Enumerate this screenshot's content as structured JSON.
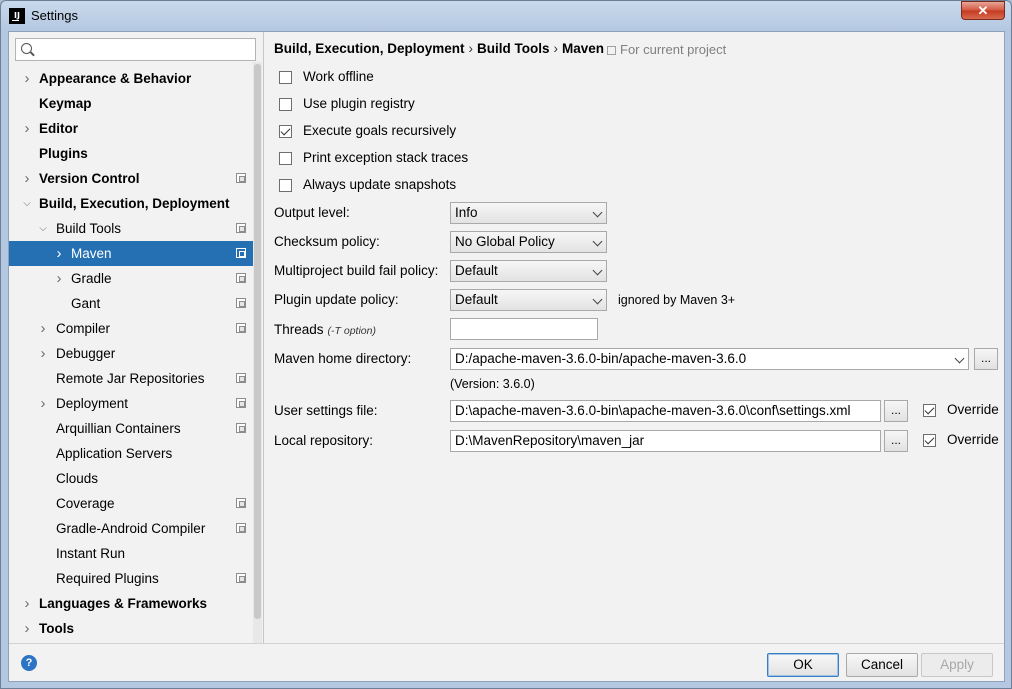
{
  "window": {
    "title": "Settings",
    "close_label": "✕"
  },
  "search": {
    "placeholder": ""
  },
  "tree": [
    {
      "label": "Appearance & Behavior",
      "depth": 0,
      "arrow": "right",
      "bold": true,
      "proj": false,
      "selected": false
    },
    {
      "label": "Keymap",
      "depth": 0,
      "arrow": "",
      "bold": true,
      "proj": false,
      "selected": false
    },
    {
      "label": "Editor",
      "depth": 0,
      "arrow": "right",
      "bold": true,
      "proj": false,
      "selected": false
    },
    {
      "label": "Plugins",
      "depth": 0,
      "arrow": "",
      "bold": true,
      "proj": false,
      "selected": false
    },
    {
      "label": "Version Control",
      "depth": 0,
      "arrow": "right",
      "bold": true,
      "proj": true,
      "selected": false
    },
    {
      "label": "Build, Execution, Deployment",
      "depth": 0,
      "arrow": "down",
      "bold": true,
      "proj": false,
      "selected": false
    },
    {
      "label": "Build Tools",
      "depth": 1,
      "arrow": "down",
      "bold": false,
      "proj": true,
      "selected": false
    },
    {
      "label": "Maven",
      "depth": 2,
      "arrow": "right",
      "bold": false,
      "proj": true,
      "selected": true
    },
    {
      "label": "Gradle",
      "depth": 2,
      "arrow": "right",
      "bold": false,
      "proj": true,
      "selected": false
    },
    {
      "label": "Gant",
      "depth": 2,
      "arrow": "",
      "bold": false,
      "proj": true,
      "selected": false
    },
    {
      "label": "Compiler",
      "depth": 1,
      "arrow": "right",
      "bold": false,
      "proj": true,
      "selected": false
    },
    {
      "label": "Debugger",
      "depth": 1,
      "arrow": "right",
      "bold": false,
      "proj": false,
      "selected": false
    },
    {
      "label": "Remote Jar Repositories",
      "depth": 1,
      "arrow": "",
      "bold": false,
      "proj": true,
      "selected": false
    },
    {
      "label": "Deployment",
      "depth": 1,
      "arrow": "right",
      "bold": false,
      "proj": true,
      "selected": false
    },
    {
      "label": "Arquillian Containers",
      "depth": 1,
      "arrow": "",
      "bold": false,
      "proj": true,
      "selected": false
    },
    {
      "label": "Application Servers",
      "depth": 1,
      "arrow": "",
      "bold": false,
      "proj": false,
      "selected": false
    },
    {
      "label": "Clouds",
      "depth": 1,
      "arrow": "",
      "bold": false,
      "proj": false,
      "selected": false
    },
    {
      "label": "Coverage",
      "depth": 1,
      "arrow": "",
      "bold": false,
      "proj": true,
      "selected": false
    },
    {
      "label": "Gradle-Android Compiler",
      "depth": 1,
      "arrow": "",
      "bold": false,
      "proj": true,
      "selected": false
    },
    {
      "label": "Instant Run",
      "depth": 1,
      "arrow": "",
      "bold": false,
      "proj": false,
      "selected": false
    },
    {
      "label": "Required Plugins",
      "depth": 1,
      "arrow": "",
      "bold": false,
      "proj": true,
      "selected": false
    },
    {
      "label": "Languages & Frameworks",
      "depth": 0,
      "arrow": "right",
      "bold": true,
      "proj": false,
      "selected": false
    },
    {
      "label": "Tools",
      "depth": 0,
      "arrow": "right",
      "bold": true,
      "proj": false,
      "selected": false
    }
  ],
  "breadcrumb": {
    "part1": "Build, Execution, Deployment",
    "part2": "Build Tools",
    "part3": "Maven",
    "sep": "›",
    "scope": "For current project"
  },
  "checkboxes": {
    "work_offline": {
      "label": "Work offline",
      "checked": false
    },
    "use_plugin_registry": {
      "label": "Use plugin registry",
      "checked": false
    },
    "execute_goals": {
      "label": "Execute goals recursively",
      "checked": true
    },
    "print_exception": {
      "label": "Print exception stack traces",
      "checked": false
    },
    "always_update": {
      "label": "Always update snapshots",
      "checked": false
    }
  },
  "fields": {
    "output_level": {
      "label": "Output level:",
      "value": "Info"
    },
    "checksum_policy": {
      "label": "Checksum policy:",
      "value": "No Global Policy"
    },
    "multiproject": {
      "label": "Multiproject build fail policy:",
      "value": "Default"
    },
    "plugin_update": {
      "label": "Plugin update policy:",
      "value": "Default",
      "note": "ignored by Maven 3+"
    },
    "threads": {
      "label": "Threads",
      "hint": "(-T option)",
      "value": ""
    },
    "maven_home": {
      "label": "Maven home directory:",
      "value": "D:/apache-maven-3.6.0-bin/apache-maven-3.6.0",
      "version": "(Version: 3.6.0)"
    },
    "user_settings": {
      "label": "User settings file:",
      "value": "D:\\apache-maven-3.6.0-bin\\apache-maven-3.6.0\\conf\\settings.xml",
      "override": "Override",
      "override_checked": true
    },
    "local_repo": {
      "label": "Local repository:",
      "value": "D:\\MavenRepository\\maven_jar",
      "override": "Override",
      "override_checked": true
    },
    "browse_label": "..."
  },
  "buttons": {
    "help": "?",
    "ok": "OK",
    "cancel": "Cancel",
    "apply": "Apply"
  }
}
